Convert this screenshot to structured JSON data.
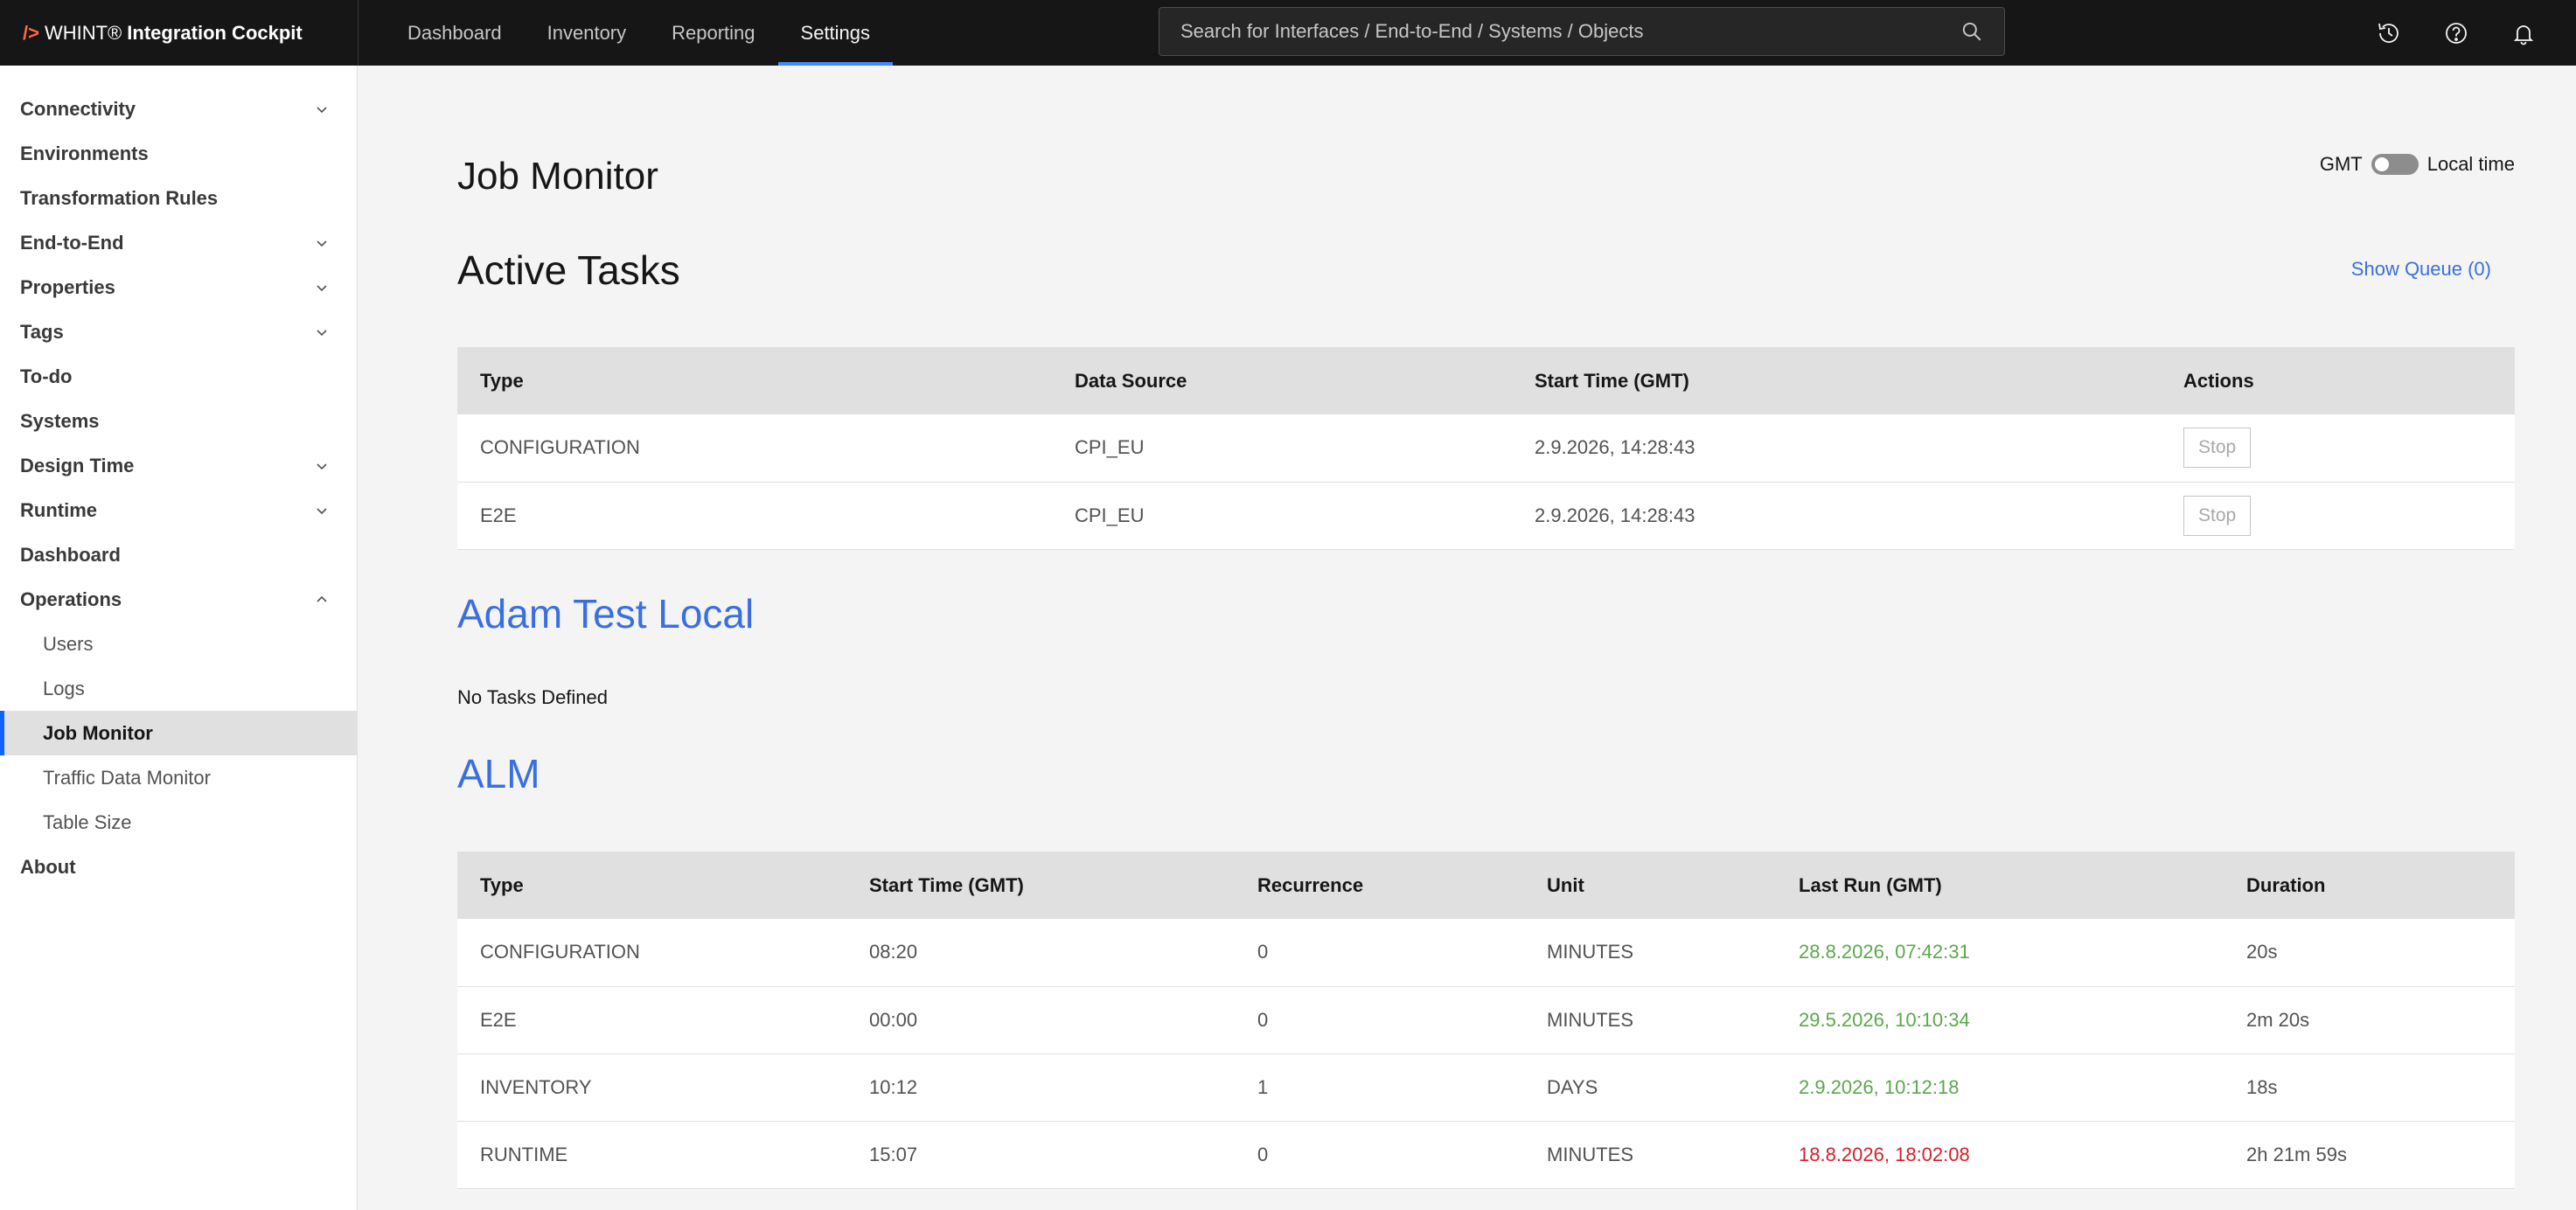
{
  "app": {
    "logo_mark": "/>",
    "brand_name": "WHINT®",
    "brand_product": "Integration Cockpit"
  },
  "nav": {
    "items": [
      {
        "label": "Dashboard"
      },
      {
        "label": "Inventory"
      },
      {
        "label": "Reporting"
      },
      {
        "label": "Settings",
        "active": true
      }
    ]
  },
  "search": {
    "placeholder": "Search for Interfaces / End-to-End / Systems / Objects",
    "icon": "search-icon"
  },
  "top_icons": [
    "history-icon",
    "help-icon",
    "notification-bell-icon"
  ],
  "sidebar": {
    "items": [
      {
        "label": "Connectivity",
        "expandable": true
      },
      {
        "label": "Environments"
      },
      {
        "label": "Transformation Rules"
      },
      {
        "label": "End-to-End",
        "expandable": true
      },
      {
        "label": "Properties",
        "expandable": true
      },
      {
        "label": "Tags",
        "expandable": true
      },
      {
        "label": "To-do"
      },
      {
        "label": "Systems"
      },
      {
        "label": "Design Time",
        "expandable": true
      },
      {
        "label": "Runtime",
        "expandable": true
      },
      {
        "label": "Dashboard"
      },
      {
        "label": "Operations",
        "expanded": true
      },
      {
        "label": "About"
      }
    ],
    "operations_children": [
      {
        "label": "Users"
      },
      {
        "label": "Logs"
      },
      {
        "label": "Job Monitor",
        "active": true
      },
      {
        "label": "Traffic Data Monitor"
      },
      {
        "label": "Table Size"
      }
    ]
  },
  "main": {
    "page_title": "Job Monitor",
    "tz": {
      "left": "GMT",
      "right": "Local time"
    },
    "active_tasks": {
      "title": "Active Tasks",
      "show_queue": "Show Queue (0)",
      "headers": [
        "Type",
        "Data Source",
        "Start Time (GMT)",
        "Actions"
      ],
      "rows": [
        {
          "type": "CONFIGURATION",
          "source": "CPI_EU",
          "start": "2.9.2026, 14:28:43",
          "action": "Stop"
        },
        {
          "type": "E2E",
          "source": "CPI_EU",
          "start": "2.9.2026, 14:28:43",
          "action": "Stop"
        }
      ]
    },
    "env1": {
      "title": "Adam Test Local",
      "empty": "No Tasks Defined"
    },
    "env2": {
      "title": "ALM",
      "headers": [
        "Type",
        "Start Time (GMT)",
        "Recurrence",
        "Unit",
        "Last Run (GMT)",
        "Duration"
      ],
      "rows": [
        {
          "type": "CONFIGURATION",
          "start": "08:20",
          "recurrence": "0",
          "unit": "MINUTES",
          "last_run": "28.8.2026, 07:42:31",
          "status": "ok",
          "duration": "20s"
        },
        {
          "type": "E2E",
          "start": "00:00",
          "recurrence": "0",
          "unit": "MINUTES",
          "last_run": "29.5.2026, 10:10:34",
          "status": "ok",
          "duration": "2m 20s"
        },
        {
          "type": "INVENTORY",
          "start": "10:12",
          "recurrence": "1",
          "unit": "DAYS",
          "last_run": "2.9.2026, 10:12:18",
          "status": "ok",
          "duration": "18s"
        },
        {
          "type": "RUNTIME",
          "start": "15:07",
          "recurrence": "0",
          "unit": "MINUTES",
          "last_run": "18.8.2026, 18:02:08",
          "status": "error",
          "duration": "2h 21m 59s"
        }
      ]
    }
  },
  "colors": {
    "accent": "#0f62fe",
    "link": "#3a6fe0",
    "success": "#5aa84a",
    "error": "#da1e28",
    "topbar": "#161616"
  }
}
